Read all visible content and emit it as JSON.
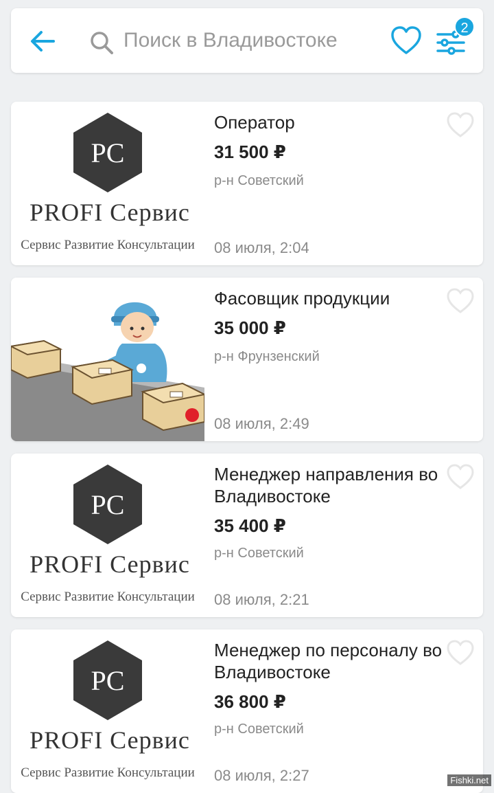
{
  "search": {
    "placeholder": "Поиск в Владивостоке",
    "filter_badge": "2"
  },
  "colors": {
    "accent": "#1aa6df",
    "logo_dark": "#3a3a3a"
  },
  "logo": {
    "initials": "PC",
    "name": "PROFI Сервис",
    "tagline": "Сервис Развитие Консультации"
  },
  "listings": [
    {
      "title": "Оператор",
      "price": "31 500 ₽",
      "district": "р-н Советский",
      "date": "08 июля, 2:04"
    },
    {
      "title": "Фасовщик продукции",
      "price": "35 000 ₽",
      "district": "р-н Фрунзенский",
      "date": "08 июля, 2:49"
    },
    {
      "title": "Менеджер направления во Владивостоке",
      "price": "35 400 ₽",
      "district": "р-н Советский",
      "date": "08 июля, 2:21"
    },
    {
      "title": "Менеджер по персоналу во Владивостоке",
      "price": "36 800 ₽",
      "district": "р-н Советский",
      "date": "08 июля, 2:27"
    }
  ],
  "watermark": "Fishki.net"
}
